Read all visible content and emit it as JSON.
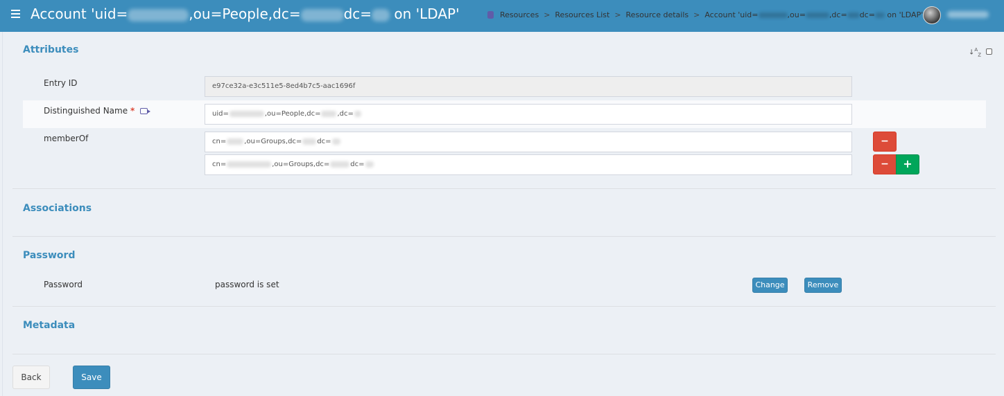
{
  "header": {
    "title_prefix": "Account 'uid=",
    "title_mid1": ",ou=People,dc=",
    "title_mid2": "dc=",
    "title_suffix": " on 'LDAP'",
    "breadcrumbs": [
      "Resources",
      "Resources List",
      "Resource details",
      "Account 'uid=",
      ",ou=",
      ",dc=",
      "dc=",
      " on 'LDAP'"
    ],
    "breadcrumb_sep": ">"
  },
  "sections": {
    "attributes": "Attributes",
    "associations": "Associations",
    "password": "Password",
    "metadata": "Metadata"
  },
  "fields": {
    "entry_id": {
      "label": "Entry ID",
      "value": "e97ce32a-e3c511e5-8ed4b7c5-aac1696f"
    },
    "dn": {
      "label": "Distinguished Name",
      "required": "*",
      "value_prefix": "uid=",
      "value_mid": ",ou=People,dc=",
      "value_mid2": ",dc="
    },
    "member_of": {
      "label": "memberOf",
      "values": [
        {
          "prefix": "cn=",
          "mid": ",ou=Groups,dc=",
          "mid2": "dc="
        },
        {
          "prefix": "cn=",
          "mid": ",ou=Groups,dc=",
          "mid2": "dc="
        }
      ]
    },
    "password": {
      "label": "Password",
      "value": "password is set"
    }
  },
  "buttons": {
    "minus": "−",
    "plus": "+",
    "change": "Change",
    "remove": "Remove",
    "back": "Back",
    "save": "Save"
  },
  "icons": {
    "menu": "hamburger-icon",
    "sort": "sort-alpha-icon",
    "resources": "database-icon",
    "dn_action": "sign-in-icon"
  },
  "colors": {
    "header": "#3c8dbc",
    "accent": "#3c8dbc",
    "danger": "#dd4b39",
    "success": "#00a65a"
  }
}
